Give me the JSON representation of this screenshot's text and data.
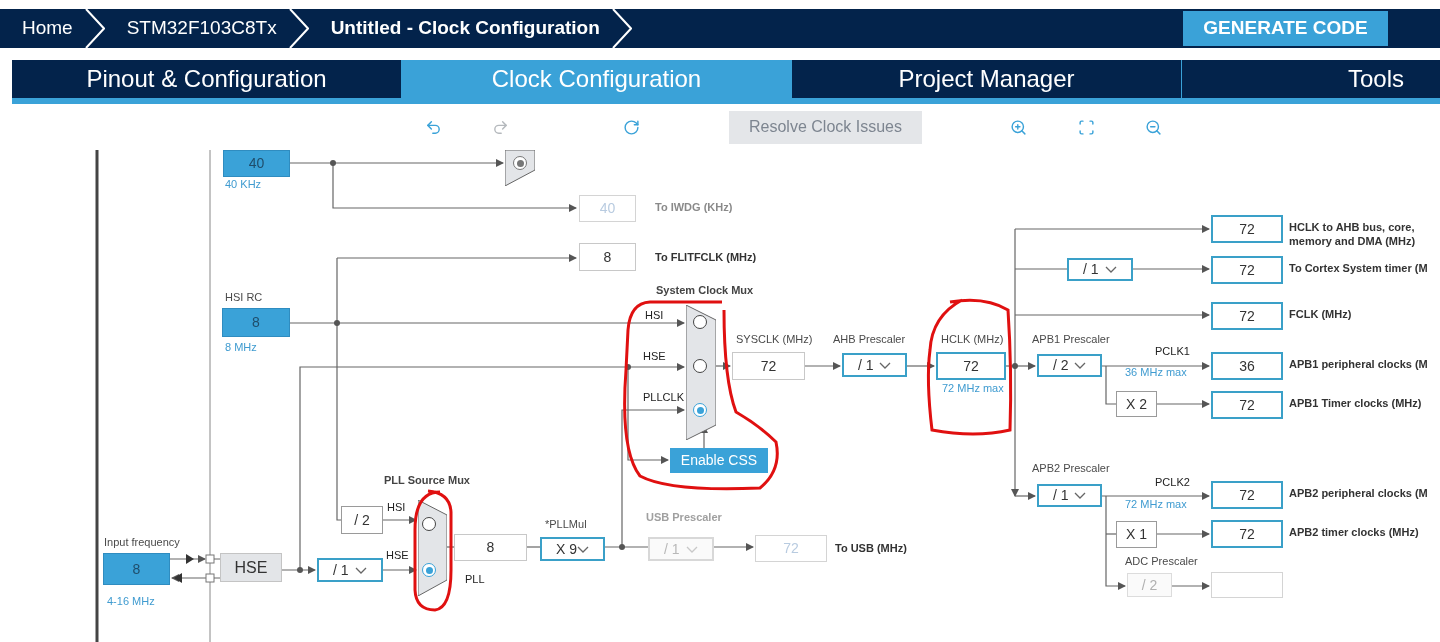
{
  "breadcrumbs": [
    {
      "label": "Home",
      "current": false
    },
    {
      "label": "STM32F103C8Tx",
      "current": false
    },
    {
      "label": "Untitled - Clock Configuration",
      "current": true
    }
  ],
  "generate_button": "GENERATE CODE",
  "tabs": [
    {
      "label": "Pinout & Configuration",
      "selected": false
    },
    {
      "label": "Clock Configuration",
      "selected": true
    },
    {
      "label": "Project Manager",
      "selected": false
    },
    {
      "label": "Tools",
      "selected": false
    }
  ],
  "toolbar": {
    "tools": [
      {
        "kind": "undo",
        "disabled": false
      },
      {
        "kind": "redo",
        "disabled": true
      },
      {
        "kind": "refresh",
        "disabled": false
      },
      {
        "kind": "resolve",
        "label": "Resolve Clock Issues",
        "disabled": true
      },
      {
        "kind": "zoom_in",
        "disabled": false
      },
      {
        "kind": "fit",
        "disabled": false
      },
      {
        "kind": "zoom_out",
        "disabled": false
      }
    ]
  },
  "diagram": {
    "value_boxes": [
      {
        "value": "40",
        "kind": "source",
        "disabled": false
      },
      {
        "value": "40",
        "kind": "plain",
        "disabled": true
      },
      {
        "value": "8",
        "kind": "plain",
        "disabled": false
      },
      {
        "value": "72",
        "kind": "output",
        "disabled": false
      },
      {
        "value": "72",
        "kind": "output",
        "disabled": false
      },
      {
        "value": "8",
        "kind": "source",
        "disabled": false
      },
      {
        "value": "72",
        "kind": "output",
        "disabled": false
      },
      {
        "value": "72",
        "kind": "plain",
        "disabled": false
      },
      {
        "value": "72",
        "kind": "output",
        "disabled": false
      },
      {
        "value": "36",
        "kind": "output",
        "disabled": false
      },
      {
        "value": "72",
        "kind": "output",
        "disabled": false
      },
      {
        "value": "72",
        "kind": "output",
        "disabled": false
      },
      {
        "value": "72",
        "kind": "output",
        "disabled": false
      },
      {
        "value": "8",
        "kind": "source",
        "disabled": false
      },
      {
        "value": "8",
        "kind": "plain",
        "disabled": false
      },
      {
        "value": "72",
        "kind": "plain",
        "disabled": true
      }
    ],
    "prescalers": [
      {
        "value": "/ 2",
        "kind": "fixed",
        "disabled": false
      },
      {
        "value": "HSE",
        "kind": "block"
      },
      {
        "value": "/ 1",
        "kind": "select",
        "disabled": false
      },
      {
        "value": "X 9",
        "kind": "select",
        "disabled": false
      },
      {
        "value": "/ 1",
        "kind": "select",
        "disabled": true
      },
      {
        "value": "/ 1",
        "kind": "select",
        "disabled": false
      },
      {
        "value": "/ 1",
        "kind": "select",
        "disabled": false
      },
      {
        "value": "/ 2",
        "kind": "select",
        "disabled": false
      },
      {
        "value": "X 2",
        "kind": "fixed",
        "disabled": false
      },
      {
        "value": "/ 1",
        "kind": "select",
        "disabled": false
      },
      {
        "value": "X 1",
        "kind": "fixed",
        "disabled": false
      },
      {
        "value": "/ 2",
        "kind": "fixed",
        "disabled": true
      }
    ],
    "muxes": [
      {
        "inputs": [
          {
            "selected": true
          }
        ]
      },
      {
        "inputs": [
          {
            "selected": false
          },
          {
            "selected": false
          },
          {
            "selected": true
          }
        ]
      },
      {
        "inputs": [
          {
            "selected": false
          },
          {
            "selected": true
          }
        ]
      }
    ],
    "css_button": "Enable CSS",
    "labels": [
      {
        "text": "40 KHz",
        "kind": "note"
      },
      {
        "text": "To IWDG (KHz)",
        "kind": "output_muted"
      },
      {
        "text": "To FLITFCLK (MHz)",
        "kind": "output"
      },
      {
        "text": "HCLK to AHB bus, core, memory and DMA (MHz)",
        "kind": "output"
      },
      {
        "text": "To Cortex System timer (M",
        "kind": "output"
      },
      {
        "text": "FCLK (MHz)",
        "kind": "output"
      },
      {
        "text": "System Clock Mux",
        "kind": "heading"
      },
      {
        "text": "HSI RC",
        "kind": "title"
      },
      {
        "text": "HSI",
        "kind": "signal"
      },
      {
        "text": "8 MHz",
        "kind": "note"
      },
      {
        "text": "SYSCLK (MHz)",
        "kind": "title"
      },
      {
        "text": "AHB Prescaler",
        "kind": "title"
      },
      {
        "text": "HCLK (MHz)",
        "kind": "title"
      },
      {
        "text": "APB1 Prescaler",
        "kind": "title"
      },
      {
        "text": "PCLK1",
        "kind": "signal"
      },
      {
        "text": "APB1 peripheral clocks (M",
        "kind": "output"
      },
      {
        "text": "HSE",
        "kind": "signal"
      },
      {
        "text": "36 MHz max",
        "kind": "note"
      },
      {
        "text": "72 MHz max",
        "kind": "note"
      },
      {
        "text": "PLLCLK",
        "kind": "signal"
      },
      {
        "text": "APB1 Timer clocks (MHz)",
        "kind": "output"
      },
      {
        "text": "APB2 Prescaler",
        "kind": "title"
      },
      {
        "text": "PCLK2",
        "kind": "signal"
      },
      {
        "text": "APB2 peripheral clocks (M",
        "kind": "output"
      },
      {
        "text": "72 MHz max",
        "kind": "note"
      },
      {
        "text": "PLL Source Mux",
        "kind": "heading"
      },
      {
        "text": "HSI",
        "kind": "signal"
      },
      {
        "text": "USB Prescaler",
        "kind": "muted"
      },
      {
        "text": "*PLLMul",
        "kind": "title"
      },
      {
        "text": "APB2 timer clocks (MHz)",
        "kind": "output"
      },
      {
        "text": "Input frequency",
        "kind": "title"
      },
      {
        "text": "HSE",
        "kind": "signal"
      },
      {
        "text": "To USB (MHz)",
        "kind": "output"
      },
      {
        "text": "ADC Prescaler",
        "kind": "title"
      },
      {
        "text": "PLL",
        "kind": "signal"
      },
      {
        "text": "4-16 MHz",
        "kind": "note"
      }
    ]
  }
}
